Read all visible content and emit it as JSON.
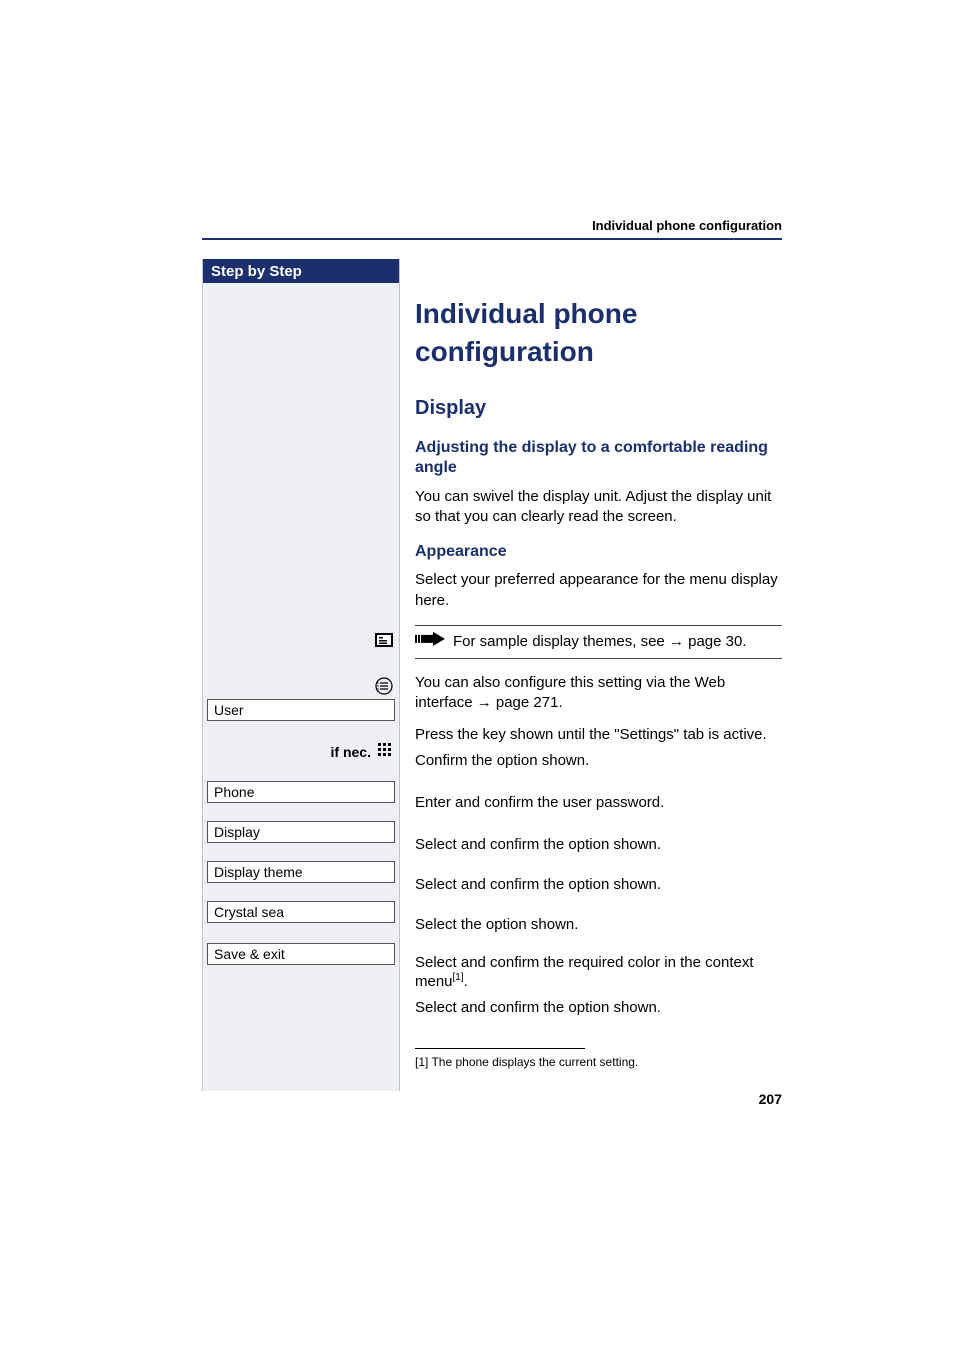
{
  "header": {
    "running_head": "Individual phone configuration",
    "step_by_step": "Step by Step"
  },
  "content": {
    "h1": "Individual phone configuration",
    "h2": "Display",
    "h3a": "Adjusting the display to a comfortable reading angle",
    "p1": "You can swivel the display unit. Adjust the display unit so that you can clearly read the screen.",
    "h3b": "Appearance",
    "p2": "Select your preferred appearance for the menu display here.",
    "note_pre": "For sample display themes, see ",
    "note_link": "→ page 30",
    "note_post": ".",
    "p3a": "You can also configure this setting via the Web interface ",
    "p3b": "→ page 271",
    "p3c": ".",
    "step_press": "Press the key shown until the \"Settings\" tab is active.",
    "step_confirm_user": "Confirm the option shown.",
    "step_password": "Enter and confirm the user password.",
    "step_phone": "Select and confirm the option shown.",
    "step_display": "Select and confirm the option shown.",
    "step_theme": "Select the option shown.",
    "step_color_a": "Select and confirm the required color in the context menu",
    "step_color_sup": "[1]",
    "step_color_b": ".",
    "step_save": "Select and confirm the option shown."
  },
  "left": {
    "if_nec": "if nec.",
    "user": "User",
    "phone": "Phone",
    "display": "Display",
    "display_theme": "Display theme",
    "crystal_sea": "Crystal sea",
    "save_exit": "Save & exit"
  },
  "footnote": {
    "text": "[1] The phone displays the current setting."
  },
  "page_number": "207"
}
